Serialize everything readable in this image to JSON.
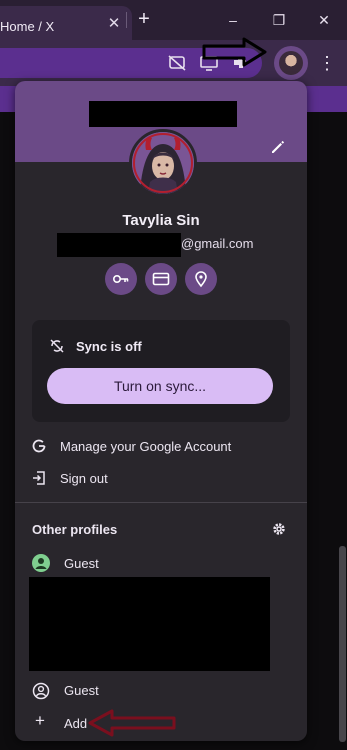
{
  "tab": {
    "title": "Home / X"
  },
  "window": {
    "minimize": "–",
    "restore": "❐",
    "close": "✕"
  },
  "menu": {
    "profile_name": "Tavylia Sin",
    "email_suffix": "@gmail.com",
    "quick_actions": [
      "key-icon",
      "card-icon",
      "location-pin-icon"
    ],
    "sync": {
      "status": "Sync is off",
      "button": "Turn on sync..."
    },
    "items": [
      {
        "label": "Manage your Google Account",
        "icon": "google-g-icon"
      },
      {
        "label": "Sign out",
        "icon": "sign-out-icon"
      }
    ],
    "other_profiles": {
      "title": "Other profiles",
      "profiles": [
        {
          "label": "Guest",
          "icon": "guest-avatar-icon"
        },
        {
          "label": "Guest",
          "icon": "guest-outline-icon"
        }
      ],
      "add_label": "Add"
    }
  },
  "colors": {
    "accent": "#6b4a87",
    "omnibox": "#5b2f8f",
    "sync_button": "#d9bcf5",
    "menu_bg": "#29262c",
    "annotation_arrow_red": "#7a0f1e"
  }
}
